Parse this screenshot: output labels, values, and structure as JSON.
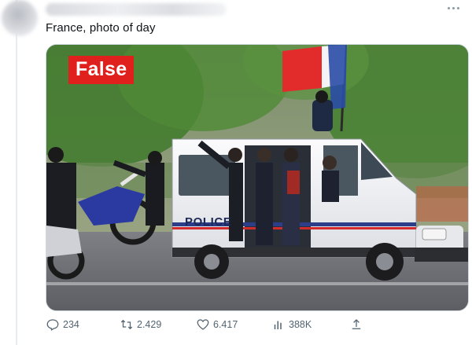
{
  "tweet": {
    "text": "France, photo of day"
  },
  "media": {
    "badge_label": "False",
    "badge_color": "#e0201d",
    "vehicle_text": "POLICE"
  },
  "actions": {
    "replies": "234",
    "reposts": "2.429",
    "likes": "6.417",
    "views": "388K"
  },
  "icons": [
    "more-icon",
    "reply-icon",
    "repost-icon",
    "like-icon",
    "views-icon",
    "share-icon"
  ]
}
